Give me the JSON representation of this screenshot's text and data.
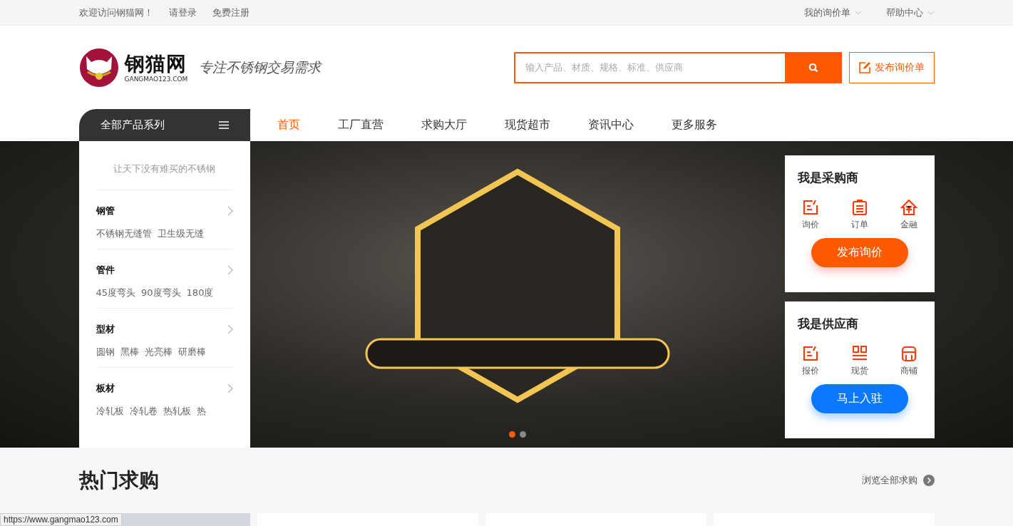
{
  "top_bar": {
    "welcome": "欢迎访问钢猫网！",
    "links": [
      "请登录",
      "免费注册"
    ],
    "menus": [
      "我的询价单",
      "帮助中心"
    ]
  },
  "header": {
    "logo_text": "钢猫网",
    "logo_domain": "GANGMAO123.COM",
    "slogan": "专注不锈钢交易需求",
    "search": {
      "placeholder": "输入产品、材质、规格、标准、供应商"
    },
    "post_button": "发布询价单"
  },
  "category_menu": {
    "title": "全部产品系列",
    "tagline": "让天下没有难买的不锈钢",
    "groups": [
      {
        "name": "钢管",
        "items": [
          "不锈钢无缝管",
          "卫生级无缝"
        ]
      },
      {
        "name": "管件",
        "items": [
          "45度弯头",
          "90度弯头",
          "180度"
        ]
      },
      {
        "name": "型材",
        "items": [
          "圆钢",
          "黑棒",
          "光亮棒",
          "研磨棒"
        ]
      },
      {
        "name": "板材",
        "items": [
          "冷轧板",
          "冷轧卷",
          "热轧板",
          "热"
        ]
      }
    ]
  },
  "nav": [
    {
      "label": "首页",
      "selected": true
    },
    {
      "label": "工厂直营",
      "selected": false
    },
    {
      "label": "求购大厅",
      "selected": false
    },
    {
      "label": "现货超市",
      "selected": false
    },
    {
      "label": "资讯中心",
      "selected": false
    },
    {
      "label": "更多服务",
      "selected": false
    }
  ],
  "carousel_dots": [
    {
      "selected": true
    },
    {
      "selected": false
    }
  ],
  "role_cards": [
    {
      "title": "我是采购商",
      "kind": "buyer",
      "actions": [
        {
          "label": "询价",
          "kind": "edit"
        },
        {
          "label": "订单",
          "kind": "clipboard"
        },
        {
          "label": "金融",
          "kind": "yen"
        }
      ],
      "button": "发布询价"
    },
    {
      "title": "我是供应商",
      "kind": "supplier",
      "actions": [
        {
          "label": "报价",
          "kind": "edit"
        },
        {
          "label": "现货",
          "kind": "grid"
        },
        {
          "label": "商铺",
          "kind": "shop"
        }
      ],
      "button": "马上入驻"
    }
  ],
  "hot_section": {
    "title": "热门求购",
    "more_link": "浏览全部求购"
  },
  "status_url": "https://www.gangmao123.com"
}
